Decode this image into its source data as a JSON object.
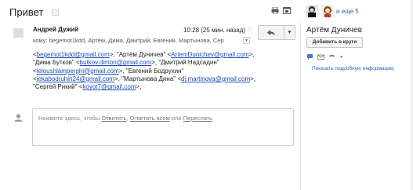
{
  "thread": {
    "subject": "Привет"
  },
  "participants": {
    "more_label": "и еще 5"
  },
  "message": {
    "sender": "Андрей Дужий",
    "date": "10:28 (25 мин. назад)",
    "recipients_line": "кому: begemot1kdd, Артём, Дима, Дмитрий, Евгений, Мартынова, Сер",
    "body": {
      "t1": "<",
      "l1": "begemot1kdd@gmail.com",
      "t2": ">,  \"Артём Дуничев\" <",
      "l2": "ArtemDunichev@gmail.com",
      "t3": ">,  \"Дима Бутков\" <",
      "l3": "butkov.dimon@gmail.com",
      "t4": ">,  \"Дмитрий Надсадин\" <",
      "l4": "leloushlamperghi@gmail.com",
      "t5": ">,  \"Евгений Бодрухин\" <",
      "l5": "jekabodruhin24@gmail.com",
      "t6": ">,  \"Мартынова Дина\" <",
      "l6": "di.martinova@gmail.com",
      "t7": ">,  \"Сергей Рикий\" <",
      "l7": "koyot7@gmail.com",
      "t8": ">,"
    }
  },
  "reply": {
    "prefix": "Нажмите здесь, чтобы ",
    "reply_link": "Ответить",
    "sep": ", ",
    "reply_all_link": "Ответить всем",
    "or_text": " или ",
    "forward_link": "Переслать"
  },
  "sidebar": {
    "contact_name": "Артём Дуничев",
    "add_circles": "Добавить в круги",
    "details_link": "Показать подробную информацию"
  },
  "icons": {
    "print": "print-icon",
    "new_window": "new-window-icon",
    "reply": "reply-arrow-icon",
    "more": "chevron-down-icon",
    "chat": "chat-bubble-icon",
    "email": "envelope-icon",
    "phone": "phone-icon"
  },
  "colors": {
    "link": "#1a4fb8",
    "chat_icon": "#4a78c2"
  }
}
